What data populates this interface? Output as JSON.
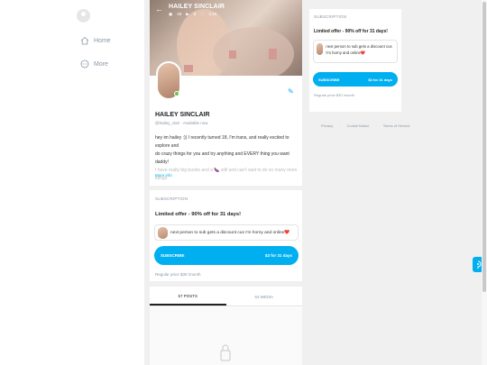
{
  "nav": {
    "home_label": "Home",
    "more_label": "More",
    "icons": [
      "user-icon",
      "home-icon",
      "more-icon"
    ]
  },
  "profile": {
    "header_name": "HAILEY SINCLAIR",
    "stats": {
      "photos": "48",
      "videos": "8",
      "likes": "3.1K"
    },
    "name": "HAILEY SINCLAIR",
    "handle": "@hailey_clair",
    "status": "Available now",
    "bio_lines": [
      "hey im hailey :)) I recently turned 18, I'm trans, and really excited to explore and",
      "do crazy things for you and try anything and EVERY thing you want daddy!",
      "I have really big boobs and a 🍆 still and can't wait to do so many more things"
    ],
    "more_info": "More info"
  },
  "subscription": {
    "header": "SUBSCRIPTION",
    "offer": "Limited offer - 90% off for 31 days!",
    "message": "next person to sub gets a discount cus I'm horny and online❤️",
    "button_label": "SUBSCRIBE",
    "button_price": "$3 for 31 days",
    "regular": "Regular price $30 /month"
  },
  "tabs": {
    "posts": "57 POSTS",
    "media": "63 MEDIA"
  },
  "sidebar": {
    "header": "SUBSCRIPTION",
    "offer": "Limited offer - 90% off for 31 days!",
    "message": "next person to sub gets a discount cus I'm horny and online❤️",
    "button_label": "SUBSCRIBE",
    "button_price": "$3 for 31 days",
    "regular": "Regular price $30 /month"
  },
  "footer": {
    "privacy": "Privacy",
    "cookie": "Cookie Notice",
    "terms": "Terms of Service"
  },
  "colors": {
    "accent": "#00aff0",
    "muted": "#8a96a3",
    "online": "#6cc24a"
  }
}
